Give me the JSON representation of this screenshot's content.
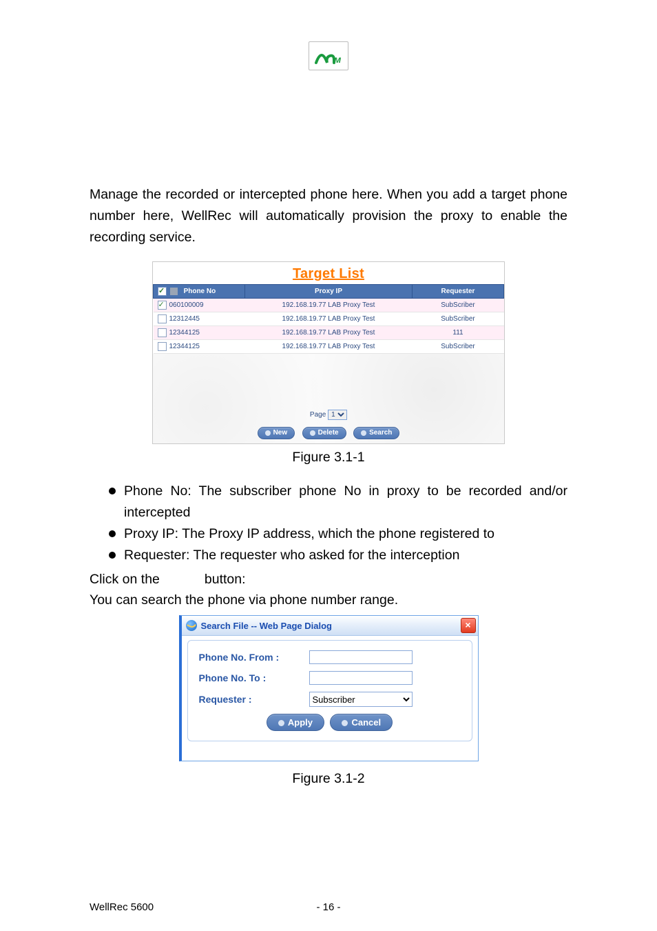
{
  "intro_paragraph": "Manage the recorded or intercepted phone here. When you add a target phone number here, WellRec will automatically provision the proxy to enable the recording service.",
  "target_list": {
    "title": "Target List",
    "columns": {
      "phone_no": "Phone No",
      "proxy_ip": "Proxy IP",
      "requester": "Requester"
    },
    "rows": [
      {
        "checked": true,
        "phone": "060100009",
        "proxy": "192.168.19.77 LAB Proxy Test",
        "requester": "SubScriber"
      },
      {
        "checked": false,
        "phone": "12312445",
        "proxy": "192.168.19.77 LAB Proxy Test",
        "requester": "SubScriber"
      },
      {
        "checked": false,
        "phone": "12344125",
        "proxy": "192.168.19.77 LAB Proxy Test",
        "requester": "111"
      },
      {
        "checked": false,
        "phone": "12344125",
        "proxy": "192.168.19.77 LAB Proxy Test",
        "requester": "SubScriber"
      }
    ],
    "pager_label": "Page",
    "pager_value": "1",
    "buttons": {
      "new": "New",
      "delete": "Delete",
      "search": "Search"
    }
  },
  "fig1_caption": "Figure 3.1-1",
  "bullets": [
    "Phone No: The subscriber phone No in proxy to be recorded and/or intercepted",
    "Proxy IP: The Proxy IP address, which the phone registered to",
    "Requester: The requester who asked for the interception"
  ],
  "click_line_a": "Click on the",
  "click_line_b": "button:",
  "search_line": "You can search the phone via phone number range.",
  "search_dialog": {
    "title": "Search File -- Web Page Dialog",
    "labels": {
      "from": "Phone No. From :",
      "to": "Phone No. To :",
      "requester": "Requester :"
    },
    "requester_value": "Subscriber",
    "buttons": {
      "apply": "Apply",
      "cancel": "Cancel"
    }
  },
  "fig2_caption": "Figure 3.1-2",
  "footer": {
    "product": "WellRec 5600",
    "page": "- 16 -"
  }
}
